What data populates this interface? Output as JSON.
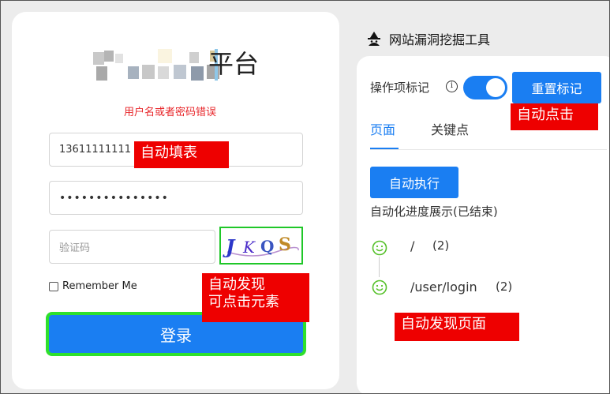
{
  "login": {
    "title": "平台",
    "error": "用户名或者密码错误",
    "username_value": "13611111111",
    "password_value": "•••••••••••••••",
    "captcha_placeholder": "验证码",
    "captcha_text": "JKQS",
    "remember_label": "Remember Me",
    "login_label": "登录"
  },
  "tool": {
    "title": "网站漏洞挖掘工具",
    "op_label": "操作项标记",
    "info_glyph": "i",
    "toggle_on": true,
    "reset_label": "重置标记",
    "tabs": [
      "页面",
      "关键点"
    ],
    "run_label": "自动执行",
    "progress_title": "自动化进度展示(已结束)",
    "timeline": [
      {
        "path": "/",
        "count": "(2)"
      },
      {
        "path": "/user/login",
        "count": "(2)"
      }
    ]
  },
  "annotations": {
    "auto_fill": "自动填表",
    "auto_discover_line1": "自动发现",
    "auto_discover_line2": "可点击元素",
    "auto_click": "自动点击",
    "auto_discover_page": "自动发现页面"
  },
  "colors": {
    "primary": "#1a7ef2",
    "annotation_red": "#ee0000",
    "highlight_green": "#2ee02c",
    "error_red": "#e8262a",
    "success_green": "#56c12a"
  }
}
